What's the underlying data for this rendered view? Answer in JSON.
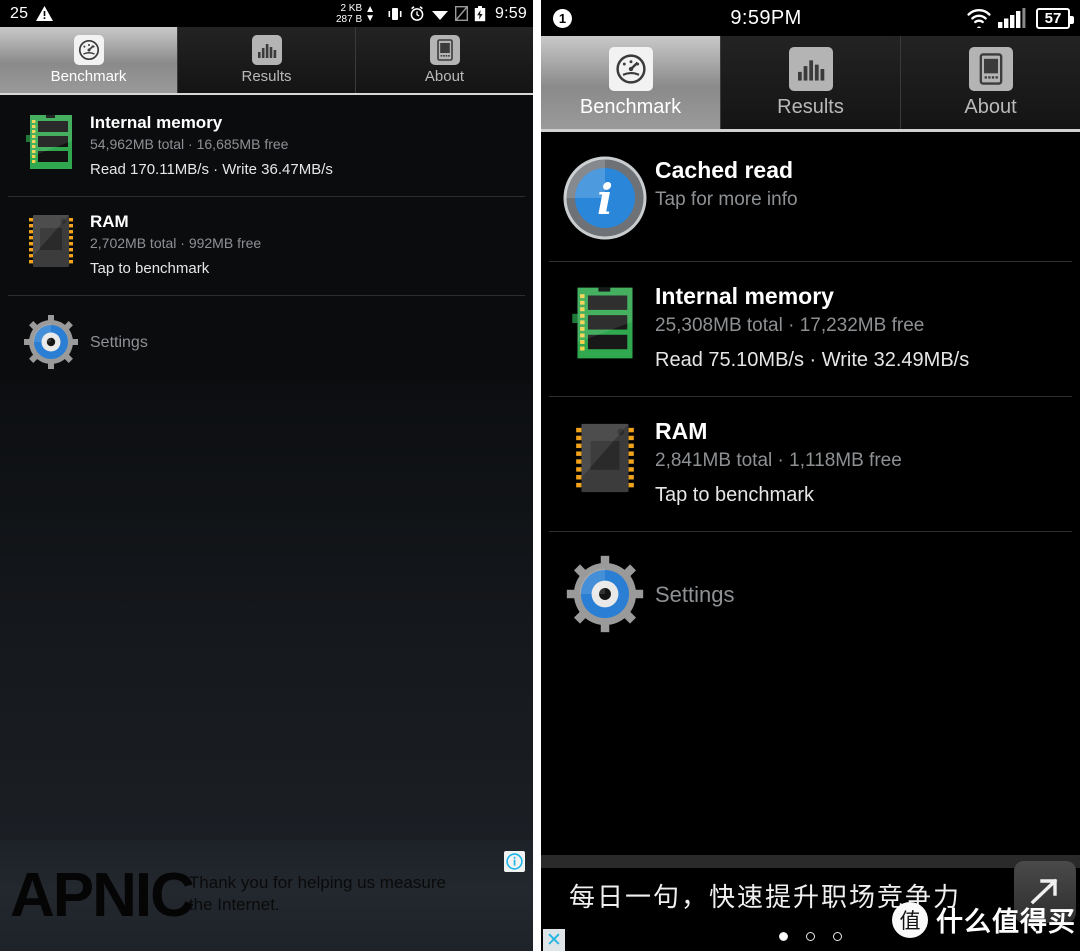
{
  "left": {
    "statusbar": {
      "notification_count": "25",
      "warning_icon": "warning-triangle-icon",
      "traffic_up": "2 KB",
      "traffic_down": "287 B",
      "icons": [
        "vibrate-icon",
        "alarm-clock-icon",
        "wifi-icon",
        "sim-missing-icon",
        "battery-charging-icon"
      ],
      "time": "9:59"
    },
    "tabs": [
      {
        "label": "Benchmark",
        "icon": "speedometer-icon",
        "active": true
      },
      {
        "label": "Results",
        "icon": "bar-chart-icon",
        "active": false
      },
      {
        "label": "About",
        "icon": "phone-icon",
        "active": false
      }
    ],
    "rows": [
      {
        "icon": "memory-stick-green-icon",
        "title": "Internal memory",
        "sub": "54,962MB total · 16,685MB free",
        "sub2": "Read 170.11MB/s · Write 36.47MB/s"
      },
      {
        "icon": "ram-chip-icon",
        "title": "RAM",
        "sub": "2,702MB total · 992MB free",
        "sub2": "Tap to benchmark"
      },
      {
        "icon": "gear-settings-icon",
        "title": "Settings"
      }
    ],
    "ad": {
      "logo": "APNIC",
      "tagline": "Thank you for helping us measure the Internet.",
      "adchoices_icon": "adchoices-info-icon"
    }
  },
  "right": {
    "statusbar": {
      "notification_badge": "1",
      "time": "9:59PM",
      "icons": [
        "wifi-icon",
        "signal-bars-icon"
      ],
      "battery_level": "57"
    },
    "tabs": [
      {
        "label": "Benchmark",
        "icon": "speedometer-icon",
        "active": true
      },
      {
        "label": "Results",
        "icon": "bar-chart-icon",
        "active": false
      },
      {
        "label": "About",
        "icon": "phone-icon",
        "active": false
      }
    ],
    "rows": [
      {
        "icon": "info-circle-icon",
        "title": "Cached read",
        "sub": "Tap for more info"
      },
      {
        "icon": "memory-stick-green-icon",
        "title": "Internal memory",
        "sub": "25,308MB total · 17,232MB free",
        "sub2": "Read 75.10MB/s · Write 32.49MB/s"
      },
      {
        "icon": "ram-chip-icon",
        "title": "RAM",
        "sub": "2,841MB total · 1,118MB free",
        "sub2": "Tap to benchmark"
      },
      {
        "icon": "gear-settings-icon",
        "title": "Settings"
      }
    ],
    "ad": {
      "headline": "每日一句，快速提升职场竞争力",
      "close_label": "✕",
      "arrow_icon": "arrow-next-icon",
      "dots": [
        "on",
        "off",
        "off"
      ],
      "watermark_mark": "值",
      "watermark_text": "什么值得买"
    }
  },
  "colors": {
    "accent_green": "#2fa84f",
    "accent_blue": "#2a86d8",
    "tab_active_text": "#ffffff",
    "subtext": "#8e9194",
    "adchoices_cyan": "#1eb6e8"
  }
}
